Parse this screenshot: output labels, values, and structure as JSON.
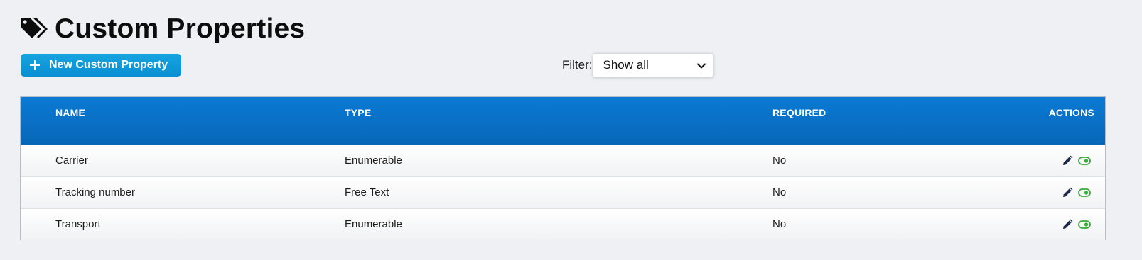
{
  "header": {
    "title": "Custom Properties",
    "title_icon": "tags-icon"
  },
  "toolbar": {
    "new_button_label": "New Custom Property",
    "filter_label": "Filter:",
    "filter_selected": "Show all"
  },
  "table": {
    "columns": [
      "NAME",
      "TYPE",
      "REQUIRED",
      "ACTIONS"
    ],
    "rows": [
      {
        "name": "Carrier",
        "type": "Enumerable",
        "required": "No"
      },
      {
        "name": "Tracking number",
        "type": "Free Text",
        "required": "No"
      },
      {
        "name": "Transport",
        "type": "Enumerable",
        "required": "No"
      }
    ],
    "row_actions": [
      "edit-pencil-icon",
      "toggle-on-icon"
    ]
  },
  "colors": {
    "background": "#eef0f3",
    "button": "#0f9bda",
    "header": "#0a72c8",
    "toggle": "#3aa93a",
    "pencil": "#1b2a4a"
  }
}
